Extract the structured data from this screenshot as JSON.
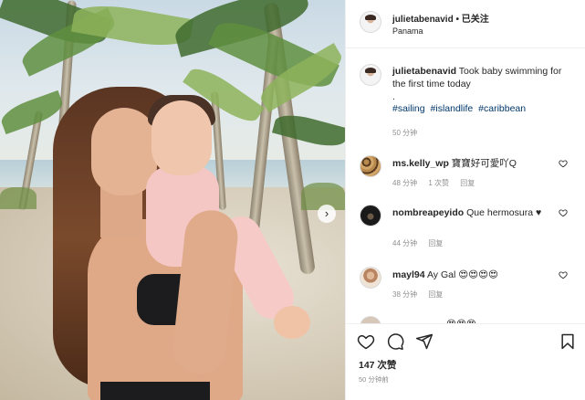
{
  "post": {
    "header": {
      "username": "julietabenavid",
      "separator": " • ",
      "follow_label": "已关注",
      "location": "Panama",
      "more_label": "•••"
    },
    "caption": {
      "username": "julietabenavid",
      "text": "Took baby swimming for the first time today",
      "dot": ".",
      "hashtags": [
        "#sailing",
        "#islandlife",
        "#caribbean"
      ],
      "time": "50 分钟"
    },
    "comments": [
      {
        "username": "ms.kelly_wp",
        "text": "寶寶好可愛吖Q",
        "time": "48 分钟",
        "likes": "1 次赞",
        "reply_label": "回复"
      },
      {
        "username": "nombreapeyido",
        "text": "Que hermosura ♥",
        "time": "44 分钟",
        "likes": "",
        "reply_label": "回复"
      },
      {
        "username": "mayl94",
        "text": "Ay Gal 😍😍😍😍",
        "time": "38 分钟",
        "likes": "",
        "reply_label": "回复"
      },
      {
        "username": "",
        "text": "😍😍😍",
        "time": "",
        "likes": "",
        "reply_label": ""
      }
    ],
    "like_count": "147 次赞",
    "posted_time": "50 分钟前",
    "next_arrow": "›"
  },
  "icons": {
    "heart": "heart-icon",
    "comment": "comment-icon",
    "share": "share-icon",
    "bookmark": "bookmark-icon",
    "more": "more-icon",
    "next": "chevron-right-icon"
  },
  "colors": {
    "hashtag": "#00376b",
    "meta": "#8e8e8e",
    "text": "#262626",
    "border": "#efefef"
  }
}
